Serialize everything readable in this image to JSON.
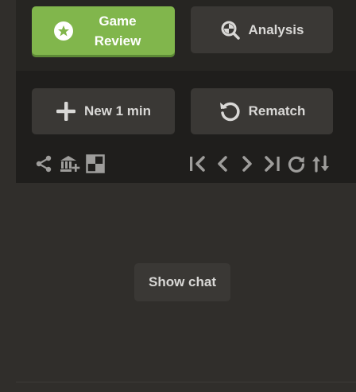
{
  "review": {
    "label": "Game\nReview",
    "icon": "star-icon",
    "color": "#81b64c"
  },
  "analysis": {
    "label": "Analysis",
    "icon": "magnifier-icon"
  },
  "new_game": {
    "label": "New 1 min",
    "icon": "plus-icon"
  },
  "rematch": {
    "label": "Rematch",
    "icon": "rematch-icon"
  },
  "toolbar": {
    "left_tools": [
      "share-icon",
      "library-add-icon",
      "board-icon"
    ],
    "nav_tools": [
      "first-move-icon",
      "previous-move-icon",
      "next-move-icon",
      "last-move-icon",
      "refresh-icon",
      "flip-board-icon"
    ]
  },
  "chat": {
    "show_label": "Show chat"
  }
}
